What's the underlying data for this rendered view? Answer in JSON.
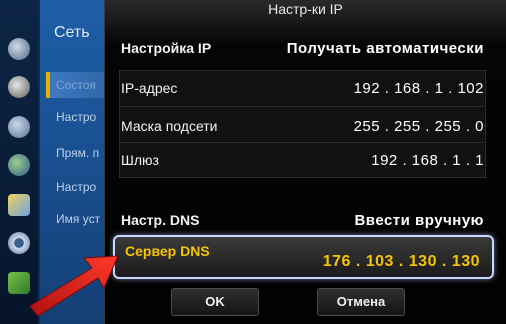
{
  "left_menu": {
    "title": "Сеть",
    "items": [
      {
        "label": "Состоя",
        "selected": true
      },
      {
        "label": "Настро",
        "selected": false
      },
      {
        "label": "Прям. п",
        "selected": false
      },
      {
        "label": "Настро",
        "selected": false
      },
      {
        "label": "Имя уст",
        "selected": false
      }
    ],
    "icons": [
      "picture-icon",
      "sound-icon",
      "broadcast-icon",
      "network-globe-icon",
      "system-icon",
      "settings-gear-icon",
      "support-icon"
    ]
  },
  "dialog": {
    "title": "Настр-ки IP",
    "ip_setting": {
      "label": "Настройка IP",
      "value": "Получать автоматически"
    },
    "ip_address": {
      "label": "IP-адрес",
      "value": "192 . 168 . 1 . 102"
    },
    "subnet_mask": {
      "label": "Маска подсети",
      "value": "255 . 255 . 255 . 0"
    },
    "gateway": {
      "label": "Шлюз",
      "value": "192 . 168 . 1 . 1"
    },
    "dns_setting": {
      "label": "Настр. DNS",
      "value": "Ввести вручную"
    },
    "dns_server": {
      "label": "Сервер DNS",
      "value": "176 . 103 . 130 . 130"
    },
    "ok_label": "OK",
    "cancel_label": "Отмена"
  },
  "colors": {
    "highlight": "#f5c400",
    "arrow": "#e02020",
    "focus_border": "#c8d7ff"
  }
}
